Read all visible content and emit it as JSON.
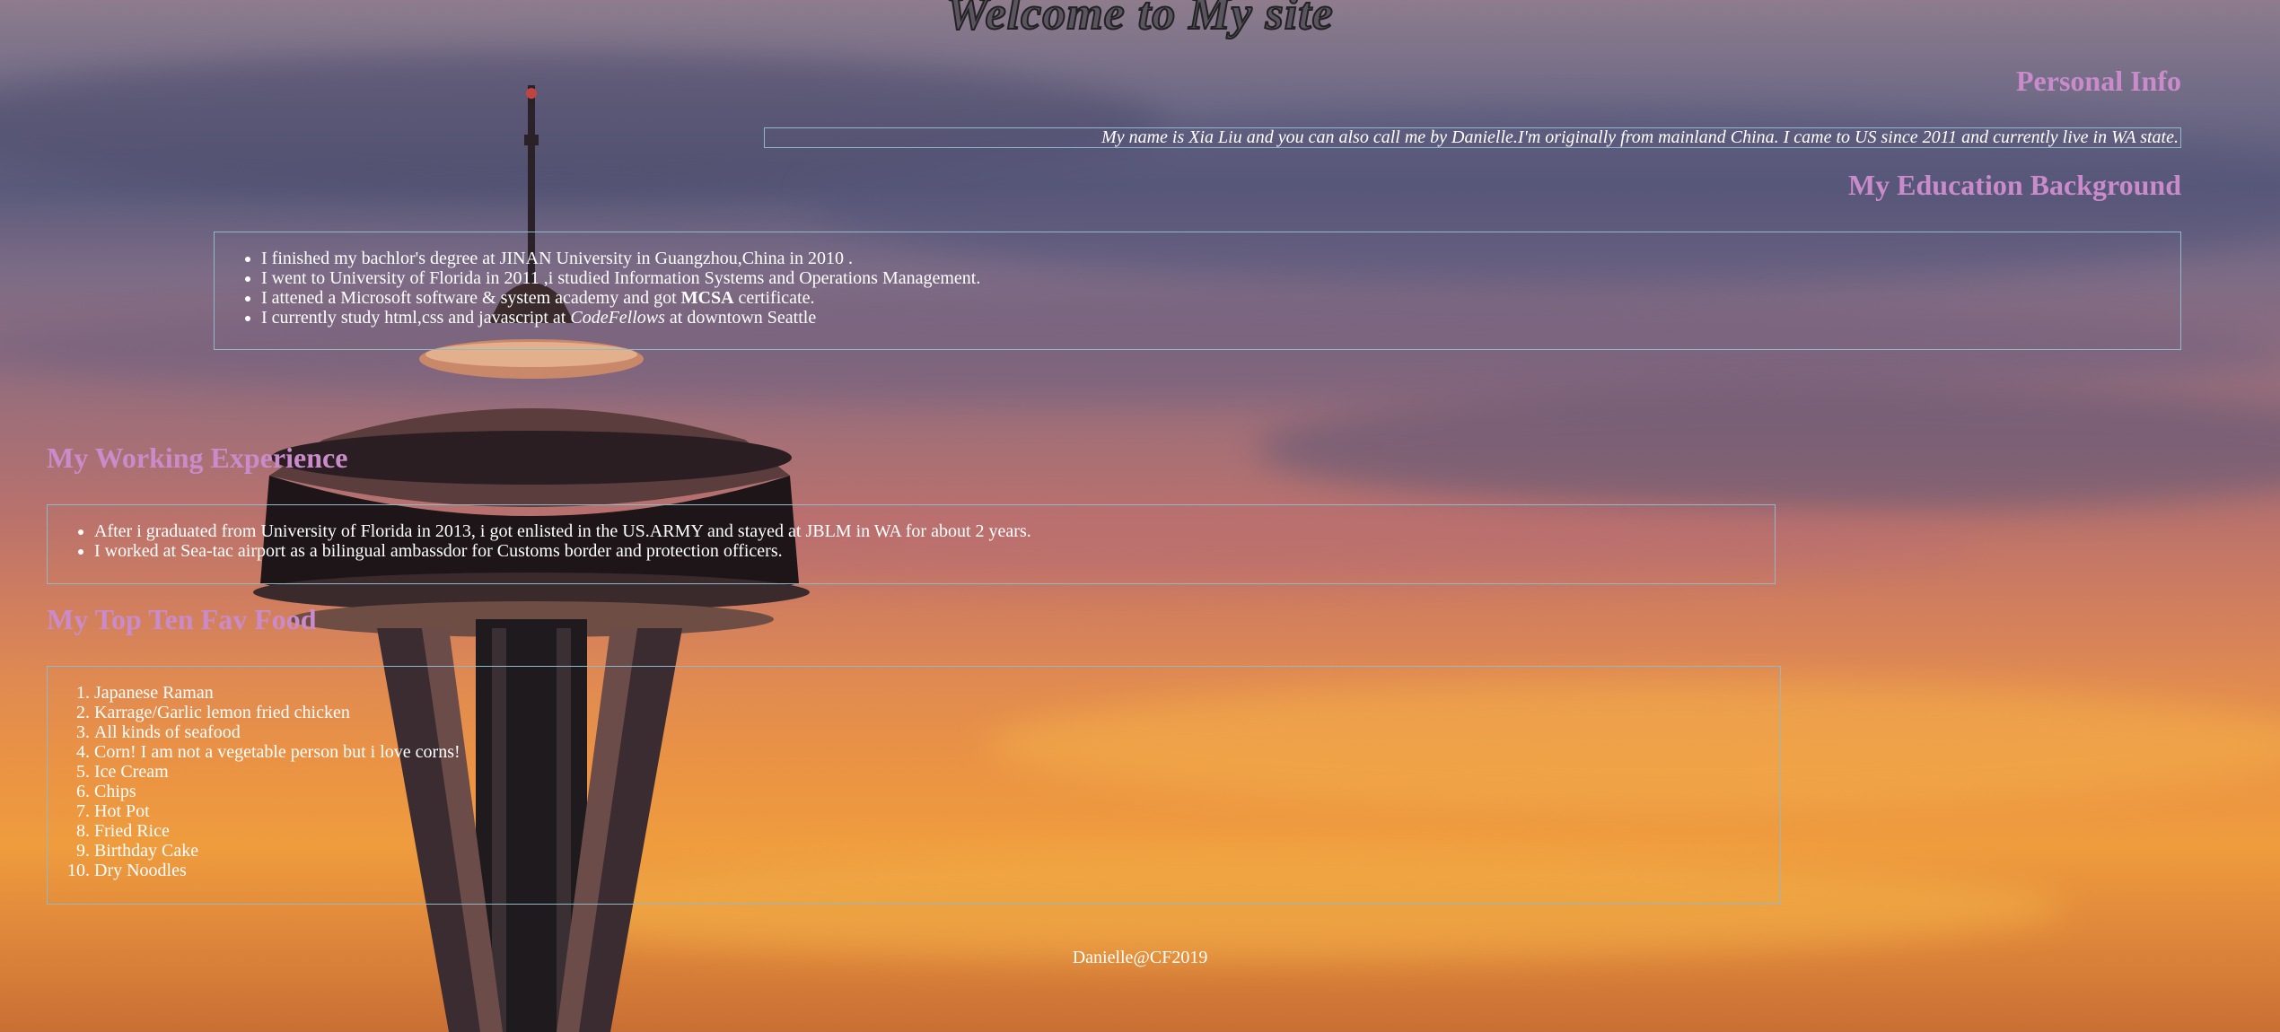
{
  "title": "Welcome to My site",
  "personal": {
    "heading": "Personal Info",
    "bio": "My name is Xia Liu and you can also call me by Danielle.I'm originally from mainland China. I came to US since 2011 and currently live in WA state."
  },
  "education": {
    "heading": "My Education Background",
    "items": [
      {
        "pre": "I finished my bachlor's degree at JINAN University in Guangzhou,China in 2010 .",
        "em": "",
        "post": ""
      },
      {
        "pre": "I went to University of Florida in 2011 ,i studied Information Systems and Operations Management.",
        "em": "",
        "post": ""
      },
      {
        "pre": "I attened a Microsoft software & system academy and got ",
        "strong": "MCSA",
        "post": " certificate."
      },
      {
        "pre": "I currently study html,css and javascript at ",
        "em": "CodeFellows",
        "post": " at downtown Seattle"
      }
    ]
  },
  "work": {
    "heading": "My Working Experience",
    "items": [
      "After i graduated from University of Florida in 2013, i got enlisted in the US.ARMY and stayed at JBLM in WA for about 2 years.",
      "I worked at Sea-tac airport as a bilingual ambassdor for Customs border and protection officers."
    ]
  },
  "food": {
    "heading": "My Top Ten Fav Food",
    "items": [
      "Japanese Raman",
      "Karrage/Garlic lemon fried chicken",
      "All kinds of seafood",
      "Corn! I am not a vegetable person but i love corns!",
      "Ice Cream",
      "Chips",
      "Hot Pot",
      "Fried Rice",
      "Birthday Cake",
      "Dry Noodles"
    ]
  },
  "footer": "Danielle@CF2019",
  "colors": {
    "heading": "#c98bc9",
    "border": "#8fb8c8",
    "text": "#ffffff"
  }
}
